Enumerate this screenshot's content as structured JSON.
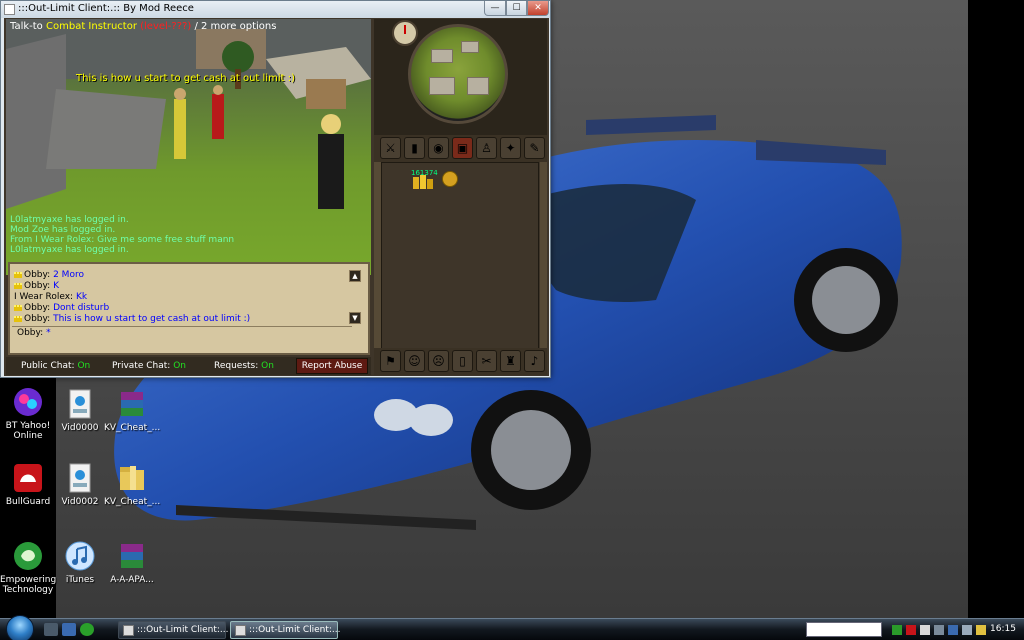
{
  "window": {
    "title": ":::Out-Limit Client:.:: By Mod Reece",
    "minimize_glyph": "—",
    "maximize_glyph": "☐",
    "close_glyph": "✕"
  },
  "game": {
    "action_prefix": "Talk-to",
    "npc_name": "Combat Instructor",
    "npc_level": "(level-???)",
    "options_text": "/ 2 more options",
    "overhead_text": "This is how u start to get cash at out limit :)",
    "game_messages": [
      "L0latmyaxe has logged in.",
      "Mod Zoe has logged in.",
      "From I Wear Rolex: Give me some free stuff mann",
      "L0latmyaxe has logged in."
    ],
    "chat_lines": [
      {
        "name": "Obby:",
        "message": "2 Moro",
        "crown": true
      },
      {
        "name": "Obby:",
        "message": "K",
        "crown": true
      },
      {
        "name": "I Wear Rolex:",
        "message": "Kk",
        "crown": false
      },
      {
        "name": "Obby:",
        "message": "Dont disturb",
        "crown": true
      },
      {
        "name": "Obby:",
        "message": "This is how u start to get cash at out limit :)",
        "crown": true
      }
    ],
    "chat_input": {
      "name": "Obby:",
      "cursor": "*"
    },
    "chat_tabs": {
      "public_label": "Public Chat:",
      "public_state": "On",
      "private_label": "Private Chat:",
      "private_state": "On",
      "requests_label": "Requests:",
      "requests_state": "On",
      "report_label": "Report Abuse"
    },
    "inventory": {
      "coins_count": "161374"
    },
    "colors": {
      "chat_message": "#0000ff",
      "game_message": "#6fffaa",
      "tab_on": "#22e022",
      "npc_name": "#ffff00",
      "npc_level": "#ff2020"
    }
  },
  "desktop_icons": [
    {
      "label": "BT Yahoo! Online",
      "icon": "yahoo-icon"
    },
    {
      "label": "BullGuard",
      "icon": "bullguard-icon"
    },
    {
      "label": "Empowering Technology",
      "icon": "empowering-icon"
    },
    {
      "label": "Vid0000",
      "icon": "3gpp-file-icon"
    },
    {
      "label": "KV_Cheat_...",
      "icon": "archive-icon"
    },
    {
      "label": "Vid0002",
      "icon": "3gpp-file-icon"
    },
    {
      "label": "KV_Cheat_...",
      "icon": "folder-icon"
    },
    {
      "label": "iTunes",
      "icon": "itunes-icon"
    },
    {
      "label": "A-A-APA...",
      "icon": "archive-icon"
    }
  ],
  "taskbar": {
    "buttons": [
      {
        "label": ":::Out-Limit Client:..."
      },
      {
        "label": ":::Out-Limit Client:..."
      }
    ],
    "search_placeholder": "",
    "clock": "16:15"
  }
}
